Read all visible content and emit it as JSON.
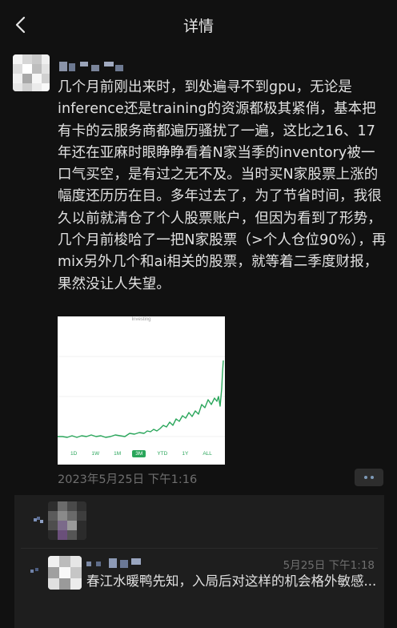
{
  "header": {
    "title": "详情",
    "back_icon": "chevron-left-icon"
  },
  "post": {
    "text": "几个月前刚出来时，到处遍寻不到gpu，无论是inference还是training的资源都极其紧俏，基本把有卡的云服务商都遍历骚扰了一遍，这比之16、17年还在亚麻时眼睁睁看着N家当季的inventory被一口气买空，是有过之无不及。当时买N家股票上涨的幅度还历历在目。多年过去了，为了节省时间，我很久以前就清仓了个人股票账户，但因为看到了形势，几个月前梭哈了一把N家股票（>个人仓位90%），再mix另外几个和ai相关的股票，就等着二季度财报，果然没让人失望。",
    "image": {
      "watermark": "Investing",
      "ranges": [
        "1D",
        "1W",
        "1M",
        "3M",
        "YTD",
        "1Y",
        "ALL"
      ],
      "active_range": "3M",
      "line_color": "#2aa65b"
    },
    "timestamp": "2023年5月25日 下午1:16",
    "more_icon": "more-dots-icon"
  },
  "comments": {
    "like_icon": "heart-icon",
    "comment_icon": "comment-icon",
    "items": [
      {
        "time": "5月25日 下午1:18",
        "text": "春江水暖鸭先知，入局后对这样的机会格外敏感..."
      }
    ]
  },
  "colors": {
    "background": "#111111",
    "comment_panel": "#1e1e1e",
    "accent_green": "#2aa65b",
    "meta_gray": "#6f6f6f"
  }
}
